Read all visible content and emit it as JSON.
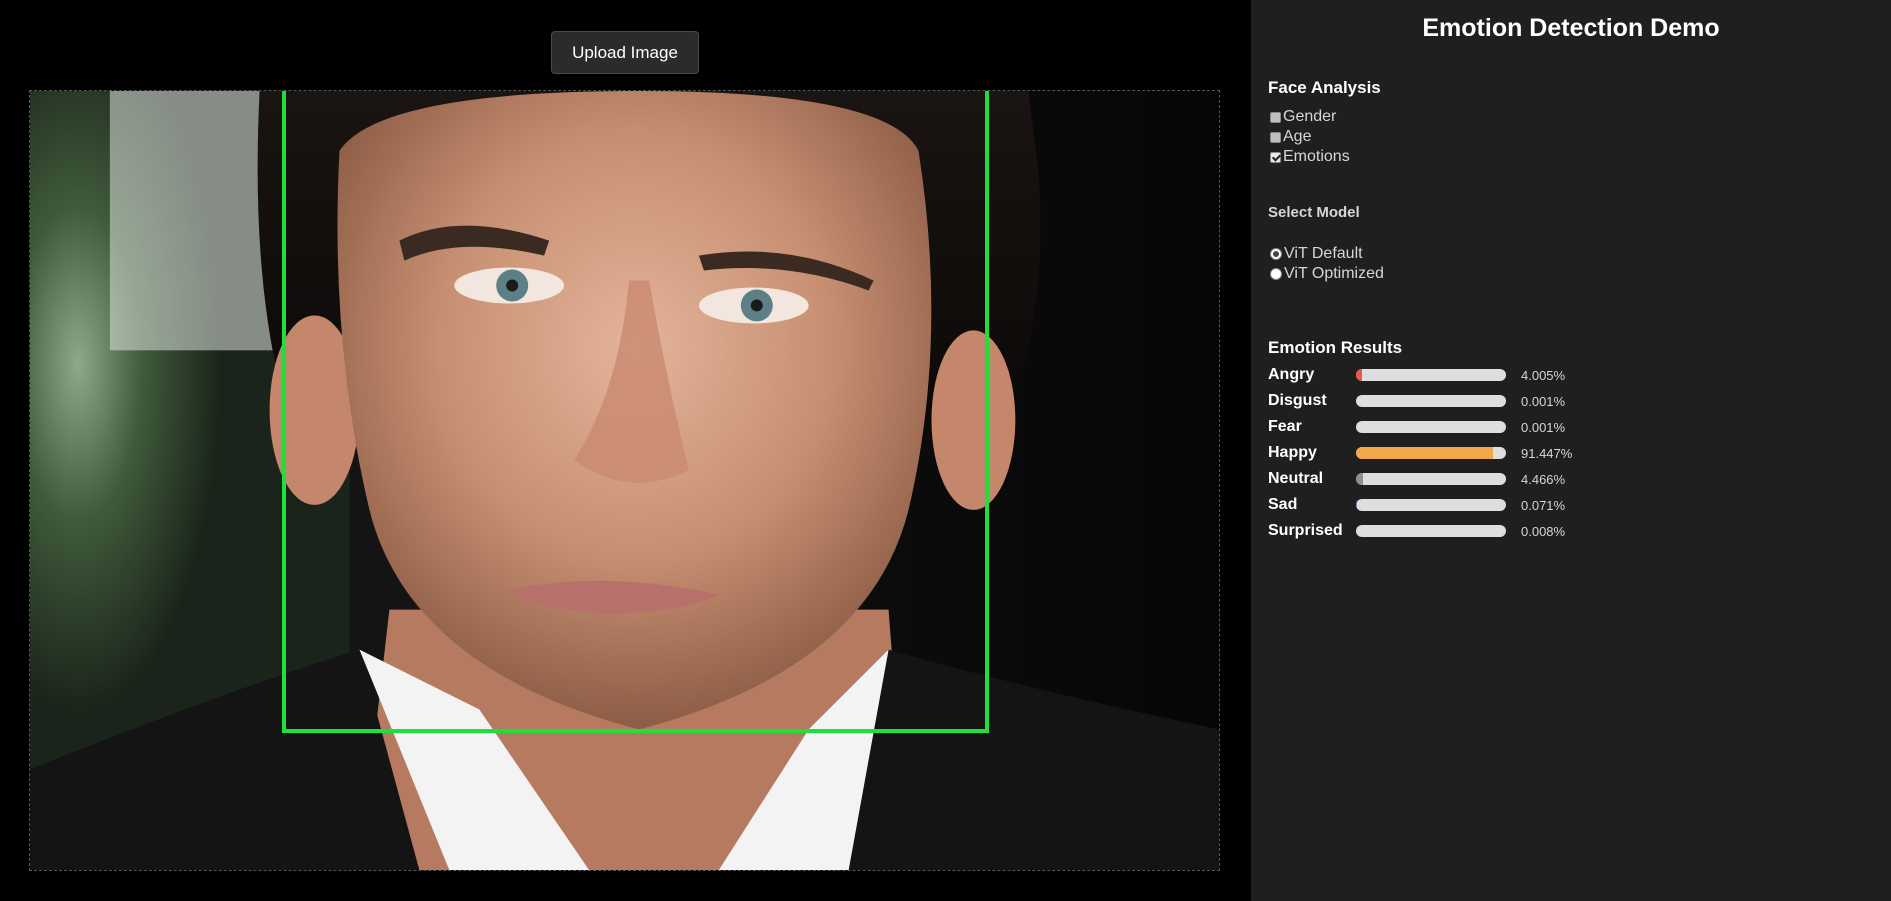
{
  "upload_label": "Upload Image",
  "panel_title": "Emotion Detection Demo",
  "face_analysis": {
    "heading": "Face Analysis",
    "options": [
      {
        "label": "Gender",
        "checked": false
      },
      {
        "label": "Age",
        "checked": false
      },
      {
        "label": "Emotions",
        "checked": true
      }
    ]
  },
  "model": {
    "heading": "Select Model",
    "options": [
      {
        "label": "ViT Default",
        "selected": true
      },
      {
        "label": "ViT Optimized",
        "selected": false
      }
    ]
  },
  "results": {
    "heading": "Emotion Results",
    "items": [
      {
        "label": "Angry",
        "value": "4.005%",
        "fraction": 0.04005,
        "color": "#e8574a"
      },
      {
        "label": "Disgust",
        "value": "0.001%",
        "fraction": 1e-05,
        "color": "#9a9a9a"
      },
      {
        "label": "Fear",
        "value": "0.001%",
        "fraction": 1e-05,
        "color": "#9a9a9a"
      },
      {
        "label": "Happy",
        "value": "91.447%",
        "fraction": 0.91447,
        "color": "#f2a84a"
      },
      {
        "label": "Neutral",
        "value": "4.466%",
        "fraction": 0.04466,
        "color": "#8e8e8e"
      },
      {
        "label": "Sad",
        "value": "0.071%",
        "fraction": 0.00071,
        "color": "#6a8fd0"
      },
      {
        "label": "Surprised",
        "value": "0.008%",
        "fraction": 8e-05,
        "color": "#c07ad0"
      }
    ]
  },
  "colors": {
    "face_box": "#1fe03a",
    "panel_bg": "#1f1f1f"
  }
}
